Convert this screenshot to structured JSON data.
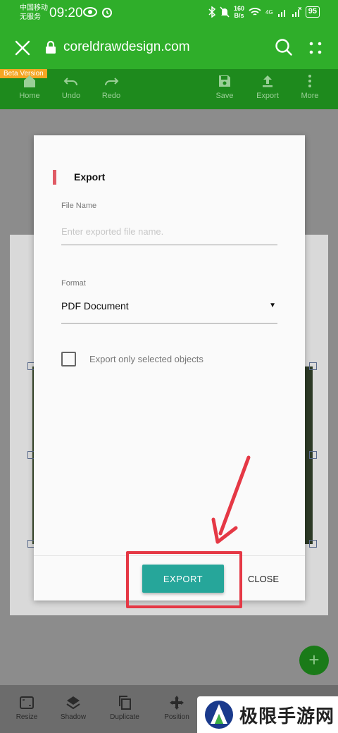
{
  "status_bar": {
    "carrier_line1": "中国移动",
    "carrier_line2": "无服务",
    "time": "09:20",
    "net_speed_value": "160",
    "net_speed_unit": "B/s",
    "signal_label": "4G",
    "battery": "95"
  },
  "browser": {
    "url": "coreldrawdesign.com",
    "icons": [
      "close-icon",
      "lock-icon",
      "search-icon",
      "more-icon"
    ]
  },
  "toolbar": {
    "beta_badge": "Beta Version",
    "items": [
      {
        "label": "Home",
        "icon": "home-icon"
      },
      {
        "label": "Undo",
        "icon": "undo-icon"
      },
      {
        "label": "Redo",
        "icon": "redo-icon"
      },
      {
        "label": "Save",
        "icon": "save-icon"
      },
      {
        "label": "Export",
        "icon": "export-icon"
      },
      {
        "label": "More",
        "icon": "more-vertical-icon"
      }
    ]
  },
  "dialog": {
    "title": "Export",
    "file_name_label": "File Name",
    "file_name_value": "",
    "file_name_placeholder": "Enter exported file name.",
    "format_label": "Format",
    "format_value": "PDF Document",
    "checkbox_label": "Export only selected objects",
    "checkbox_checked": false,
    "export_button": "EXPORT",
    "close_button": "CLOSE"
  },
  "bottom_bar": {
    "items": [
      {
        "label": "Resize",
        "icon": "resize-icon"
      },
      {
        "label": "Shadow",
        "icon": "layers-icon"
      },
      {
        "label": "Duplicate",
        "icon": "duplicate-icon"
      },
      {
        "label": "Position",
        "icon": "move-icon"
      }
    ]
  },
  "fab": {
    "symbol": "+"
  },
  "watermark": {
    "text": "极限手游网"
  },
  "colors": {
    "header_green": "#2fae2a",
    "toolbar_green": "#1e8a1d",
    "accent_teal": "#26a69a",
    "annotation_red": "#e53845"
  }
}
